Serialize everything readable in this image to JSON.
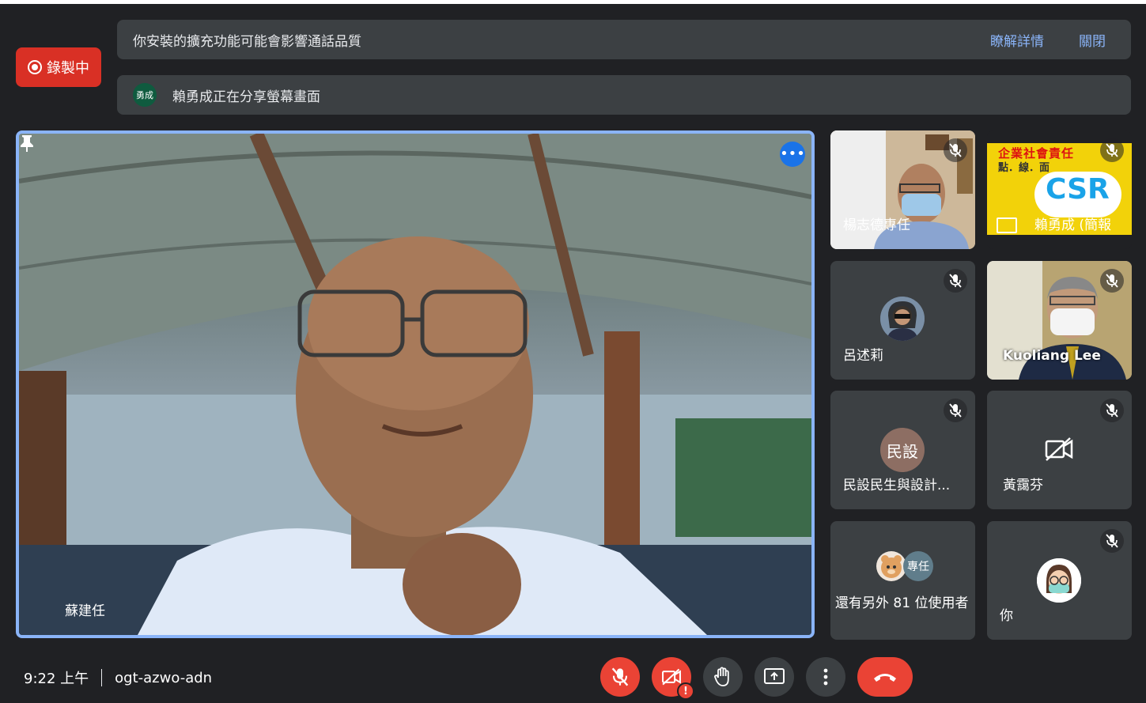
{
  "recording": {
    "label": "錄製中"
  },
  "banners": {
    "extension_warning": "你安裝的擴充功能可能會影響通話品質",
    "learn_more": "瞭解詳情",
    "close": "關閉",
    "sharing_avatar": "勇成",
    "sharing_text": "賴勇成正在分享螢幕畫面"
  },
  "main_tile": {
    "name": "蘇建任"
  },
  "tiles": [
    {
      "name": "楊志德專任",
      "muted": true
    },
    {
      "name": "賴勇成 (簡報",
      "muted": true,
      "content": "企業社會責任 點．線．面 CSR"
    },
    {
      "name": "呂述莉",
      "muted": true
    },
    {
      "name": "Kuoliang Lee",
      "muted": true
    },
    {
      "name": "民設民生與設計...",
      "avatar_text": "民設",
      "muted": true
    },
    {
      "name": "黃靄芬",
      "muted": true
    },
    {
      "name": "還有另外 81 位使用者",
      "avatar_text": "專任"
    },
    {
      "name": "你",
      "muted": true
    }
  ],
  "bottom": {
    "time": "9:22 上午",
    "meeting_code": "ogt-azwo-adn"
  },
  "controls": [
    {
      "label": "mic-off"
    },
    {
      "label": "camera-off",
      "badge": "!"
    },
    {
      "label": "raise-hand"
    },
    {
      "label": "present-now"
    },
    {
      "label": "more-options"
    },
    {
      "label": "leave-call"
    }
  ],
  "colors": {
    "accent": "#8ab4f8",
    "danger": "#ea4335",
    "tile_bg": "#3c4043",
    "bg": "#202124"
  }
}
